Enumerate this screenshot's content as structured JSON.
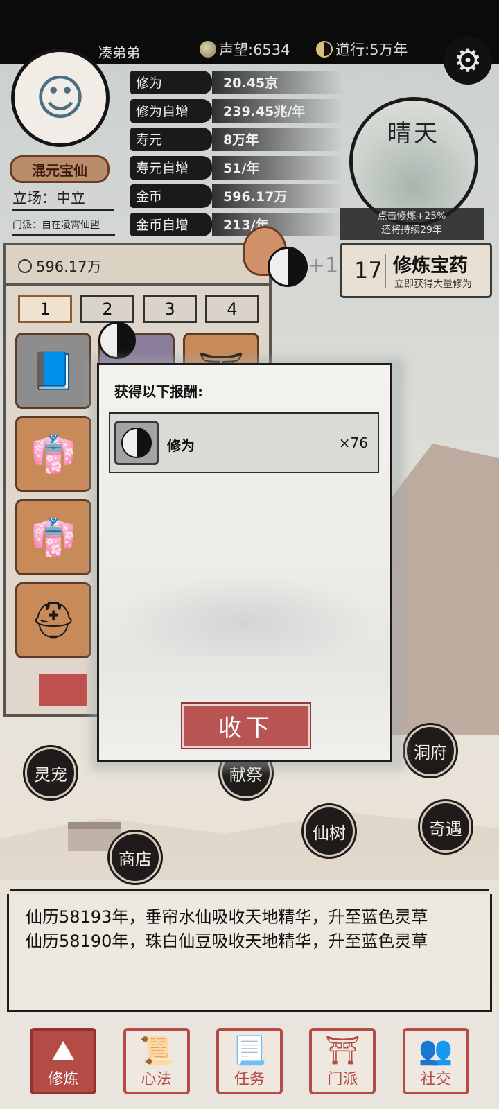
{
  "header": {
    "player_name": "凑弟弟",
    "reputation": "声望:6534",
    "dao_practice": "道行:5万年",
    "settings_icon": "gear-icon"
  },
  "profile": {
    "rank": "混元宝仙",
    "stance": "立场：中立",
    "sect": "门派：自在凌霄仙盟"
  },
  "stats": [
    {
      "label": "修为",
      "value": "20.45京"
    },
    {
      "label": "修为自增",
      "value": "239.45兆/年"
    },
    {
      "label": "寿元",
      "value": "8万年"
    },
    {
      "label": "寿元自增",
      "value": "51/年"
    },
    {
      "label": "金币",
      "value": "596.17万"
    },
    {
      "label": "金币自增",
      "value": "213/年"
    }
  ],
  "weather": {
    "label": "晴天",
    "tip_line1": "点击修炼+25%",
    "tip_line2": "还将持续29年"
  },
  "medicine": {
    "count": "17",
    "title": "修炼宝药",
    "subtitle": "立即获得大量修为"
  },
  "floating_gain": "+1",
  "inventory": {
    "money": "596.17万",
    "tabs": [
      "1",
      "2",
      "3",
      "4"
    ],
    "active_tab": "1"
  },
  "modal": {
    "title": "获得以下报酬:",
    "reward": {
      "name": "修为",
      "quantity": "×76",
      "icon": "taiji-icon"
    },
    "accept_label": "收下"
  },
  "map_buttons": {
    "pet": "灵宠",
    "sacrifice": "献祭",
    "cave": "洞府",
    "tree": "仙树",
    "encounter": "奇遇",
    "shop": "商店"
  },
  "log": [
    "仙历58193年，垂帘水仙吸收天地精华，升至蓝色灵草",
    "仙历58190年，珠白仙豆吸收天地精华，升至蓝色灵草"
  ],
  "nav": [
    {
      "label": "修炼",
      "active": true
    },
    {
      "label": "心法",
      "active": false
    },
    {
      "label": "任务",
      "active": false
    },
    {
      "label": "门派",
      "active": false
    },
    {
      "label": "社交",
      "active": false
    }
  ],
  "colors": {
    "accent_red": "#b85552",
    "ink_black": "#1a1a1a",
    "paper": "#ecebe7"
  }
}
